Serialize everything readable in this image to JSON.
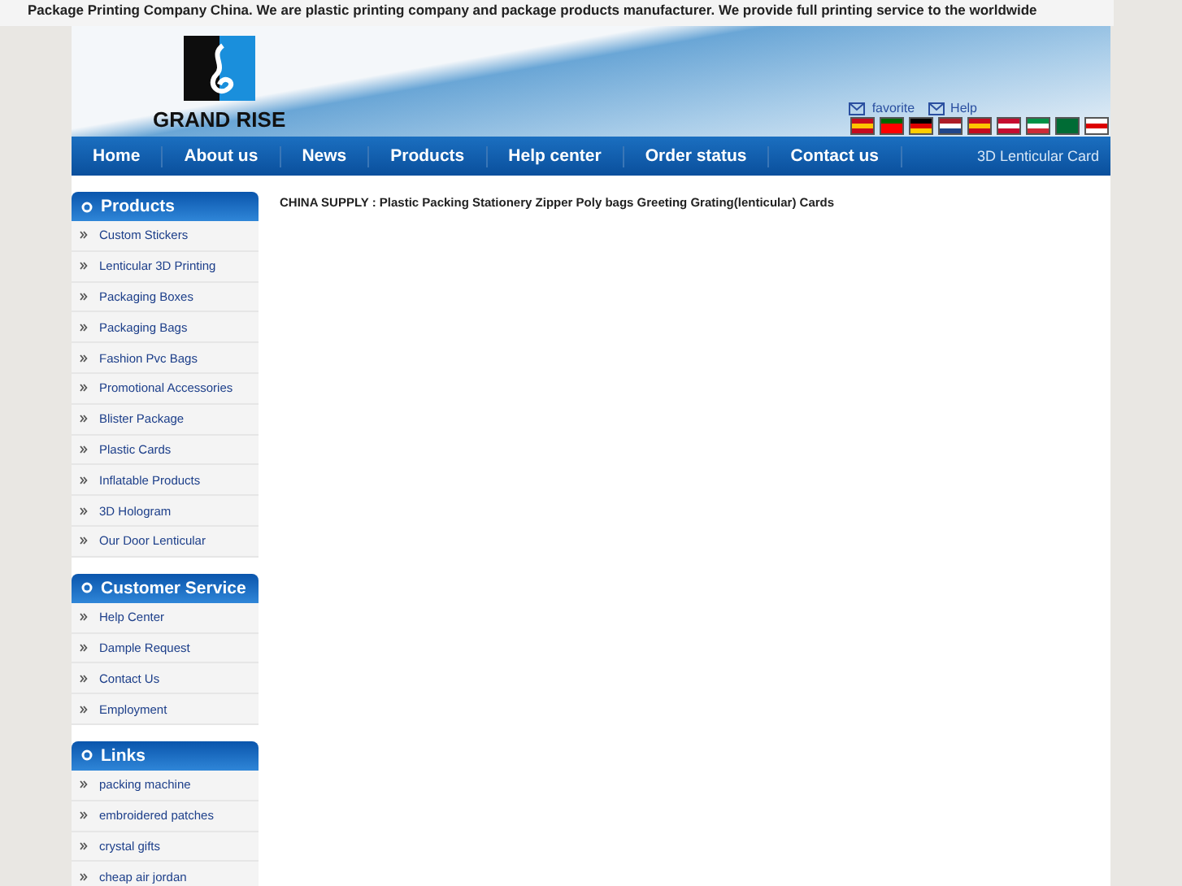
{
  "top_bar": {
    "text": "Package Printing Company China. We are plastic printing company and package products manufacturer. We provide full printing service to the worldwide"
  },
  "logo": {
    "text": "GRAND RISE"
  },
  "header_links": [
    "favorite",
    "Help"
  ],
  "nav": {
    "items": [
      "Home",
      "About us",
      "News",
      "Products",
      "Help center",
      "Order status",
      "Contact us"
    ],
    "right_text": "3D Lenticular Card"
  },
  "sidebar": [
    {
      "title": "Products",
      "items": [
        "Custom Stickers",
        "Lenticular 3D Printing",
        "Packaging Boxes",
        "Packaging Bags",
        "Fashion Pvc Bags",
        "Promotional Accessories",
        "Blister Package",
        "Plastic Cards",
        "Inflatable Products",
        "3D Hologram",
        "Our Door Lenticular"
      ]
    },
    {
      "title": "Customer Service",
      "items": [
        "Help Center",
        "Dample Request",
        "Contact Us",
        "Employment"
      ]
    },
    {
      "title": "Links",
      "items": [
        "packing machine",
        "embroidered patches",
        "crystal gifts",
        "cheap air jordan"
      ]
    }
  ],
  "main": {
    "heading": "CHINA SUPPLY : Plastic Packing Stationery Zipper Poly bags Greeting Grating(lenticular) Cards"
  }
}
